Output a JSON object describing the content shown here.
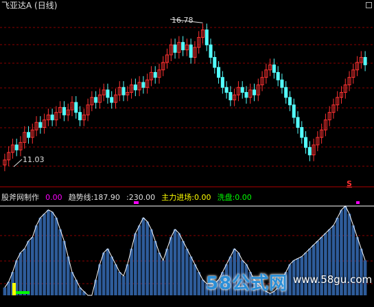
{
  "header": {
    "title": "飞亚达A (日线)"
  },
  "price_panel": {
    "high_label": "16.78",
    "low_label": "11.03",
    "signal_mark": "S"
  },
  "indicator_panel": {
    "name": "股斧网制作",
    "v1": "0.00",
    "trend_label": "趋势线:187.90",
    "v2": ":230.00",
    "main_inflow_label": "主力进场:0.00",
    "washout_label": "洗盘:0.00"
  },
  "watermark": {
    "logo": "58公式网",
    "url": "www.58gu.com"
  },
  "colors": {
    "background": "#000000",
    "up_candle": "#ff3232",
    "down_candle": "#54ffff",
    "grid": "#8b0000",
    "hist": "#2e5c9a",
    "envelope": "#ffffff",
    "magenta": "#ff00ff",
    "yellow": "#ffff00",
    "green": "#00ff00"
  },
  "chart_data": [
    {
      "type": "candlestick",
      "title": "飞亚达A (日线)",
      "annotations": [
        {
          "text": "16.78",
          "kind": "max"
        },
        {
          "text": "11.03",
          "kind": "min"
        }
      ],
      "ylim": [
        10.5,
        17.2
      ],
      "close": [
        11.3,
        11.6,
        11.9,
        11.7,
        12.0,
        12.4,
        12.2,
        12.5,
        12.8,
        12.6,
        12.9,
        13.1,
        12.9,
        13.2,
        13.4,
        13.1,
        13.3,
        13.6,
        13.2,
        12.9,
        13.1,
        13.5,
        13.8,
        13.6,
        13.9,
        14.1,
        13.8,
        13.6,
        13.9,
        14.2,
        13.9,
        14.0,
        14.3,
        14.1,
        14.4,
        14.2,
        14.5,
        14.8,
        14.6,
        14.9,
        15.2,
        15.5,
        15.9,
        15.6,
        16.0,
        15.7,
        15.9,
        15.4,
        15.8,
        16.2,
        16.5,
        15.9,
        15.4,
        15.0,
        14.6,
        14.2,
        14.0,
        13.7,
        13.9,
        14.2,
        14.0,
        13.8,
        14.1,
        13.9,
        14.3,
        14.6,
        14.9,
        15.1,
        14.8,
        14.5,
        14.2,
        13.8,
        13.5,
        13.0,
        12.6,
        12.2,
        11.8,
        11.5,
        11.9,
        12.2,
        12.5,
        12.9,
        13.2,
        13.5,
        13.8,
        14.0,
        14.3,
        14.6,
        14.9,
        15.2,
        15.4,
        15.1
      ],
      "open": [
        11.1,
        11.3,
        11.6,
        11.9,
        11.7,
        12.0,
        12.4,
        12.2,
        12.5,
        12.8,
        12.6,
        12.9,
        13.1,
        12.9,
        13.2,
        13.4,
        13.1,
        13.3,
        13.6,
        13.2,
        12.9,
        13.1,
        13.5,
        13.8,
        13.6,
        13.9,
        14.1,
        13.8,
        13.6,
        13.9,
        14.2,
        13.9,
        14.0,
        14.3,
        14.1,
        14.4,
        14.2,
        14.5,
        14.8,
        14.6,
        14.9,
        15.2,
        15.5,
        15.9,
        15.6,
        16.0,
        15.7,
        15.9,
        15.4,
        15.8,
        16.2,
        16.5,
        15.9,
        15.4,
        15.0,
        14.6,
        14.2,
        14.0,
        13.7,
        13.9,
        14.2,
        14.0,
        13.8,
        14.1,
        13.9,
        14.3,
        14.6,
        14.9,
        15.1,
        14.8,
        14.5,
        14.2,
        13.8,
        13.5,
        13.0,
        12.6,
        12.2,
        11.8,
        11.5,
        11.9,
        12.2,
        12.5,
        12.9,
        13.2,
        13.5,
        13.8,
        14.0,
        14.3,
        14.6,
        14.9,
        15.2,
        15.4
      ],
      "high_value": 16.78,
      "low_value": 11.03
    },
    {
      "type": "bar",
      "series": [
        {
          "name": "趋势线",
          "last_value": 187.9
        },
        {
          "name": "主力进场",
          "last_value": 0.0
        },
        {
          "name": "洗盘",
          "last_value": 0.0
        }
      ],
      "ylim": [
        0,
        230
      ],
      "reference_line": 230.0,
      "values": [
        20,
        35,
        60,
        90,
        110,
        120,
        140,
        150,
        180,
        200,
        210,
        220,
        215,
        200,
        170,
        140,
        100,
        60,
        40,
        20,
        10,
        0,
        0,
        40,
        80,
        110,
        120,
        100,
        80,
        60,
        50,
        80,
        120,
        160,
        180,
        200,
        190,
        170,
        140,
        110,
        90,
        120,
        150,
        170,
        160,
        140,
        120,
        100,
        80,
        60,
        40,
        30,
        30,
        30,
        40,
        60,
        80,
        100,
        120,
        110,
        90,
        80,
        60,
        40,
        30,
        20,
        10,
        5,
        10,
        20,
        40,
        60,
        80,
        90,
        95,
        100,
        110,
        120,
        130,
        140,
        150,
        160,
        170,
        180,
        200,
        220,
        230,
        210,
        180,
        150,
        120,
        90
      ]
    }
  ]
}
